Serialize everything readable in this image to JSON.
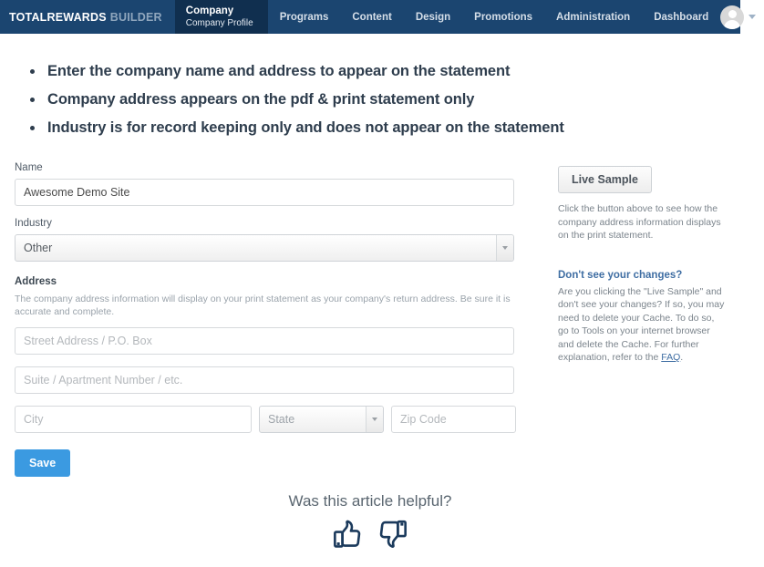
{
  "navbar": {
    "brand_main": "TOTALREWARDS",
    "brand_sub": "BUILDER",
    "active_tab": {
      "title": "Company",
      "subtitle": "Company Profile"
    },
    "items": [
      {
        "label": "Programs"
      },
      {
        "label": "Content"
      },
      {
        "label": "Design"
      },
      {
        "label": "Promotions"
      },
      {
        "label": "Administration"
      },
      {
        "label": "Dashboard"
      }
    ],
    "background_color": "#1b4570",
    "active_background_color": "#102f4f",
    "avatar_icon": "user-avatar-icon",
    "caret_icon": "chevron-down-icon"
  },
  "bullets": [
    "Enter the company name and address to appear on the statement",
    "Company address appears on the pdf & print statement only",
    "Industry is for record keeping only and does not appear on the statement"
  ],
  "form": {
    "name_label": "Name",
    "name_value": "Awesome Demo Site",
    "name_placeholder": "",
    "industry_label": "Industry",
    "industry_value": "Other",
    "address_label": "Address",
    "address_help": "The company address information will display on your print statement as your company's return address. Be sure it is accurate and complete.",
    "street_placeholder": "Street Address / P.O. Box",
    "suite_placeholder": "Suite / Apartment Number / etc.",
    "city_placeholder": "City",
    "state_value": "State",
    "zip_placeholder": "Zip Code",
    "save_label": "Save",
    "save_color": "#3b9ae1"
  },
  "sidebar": {
    "live_sample_label": "Live Sample",
    "live_sample_help": "Click the button above to see how the company address information displays on the print statement.",
    "changes_heading": "Don't see your changes?",
    "changes_text_before": "Are you clicking the \"Live Sample\" and don't see your changes? If so, you may need to delete your Cache. To do so, go to Tools on your internet browser and delete the Cache. For further explanation, refer to the ",
    "faq_link": "FAQ",
    "changes_text_after": ".",
    "link_color": "#3f6ea3"
  },
  "footer": {
    "helpful_title": "Was this article helpful?",
    "thumbs_up_icon": "thumbs-up-icon",
    "thumbs_down_icon": "thumbs-down-icon",
    "thumbs_color": "#1b3a5c"
  }
}
